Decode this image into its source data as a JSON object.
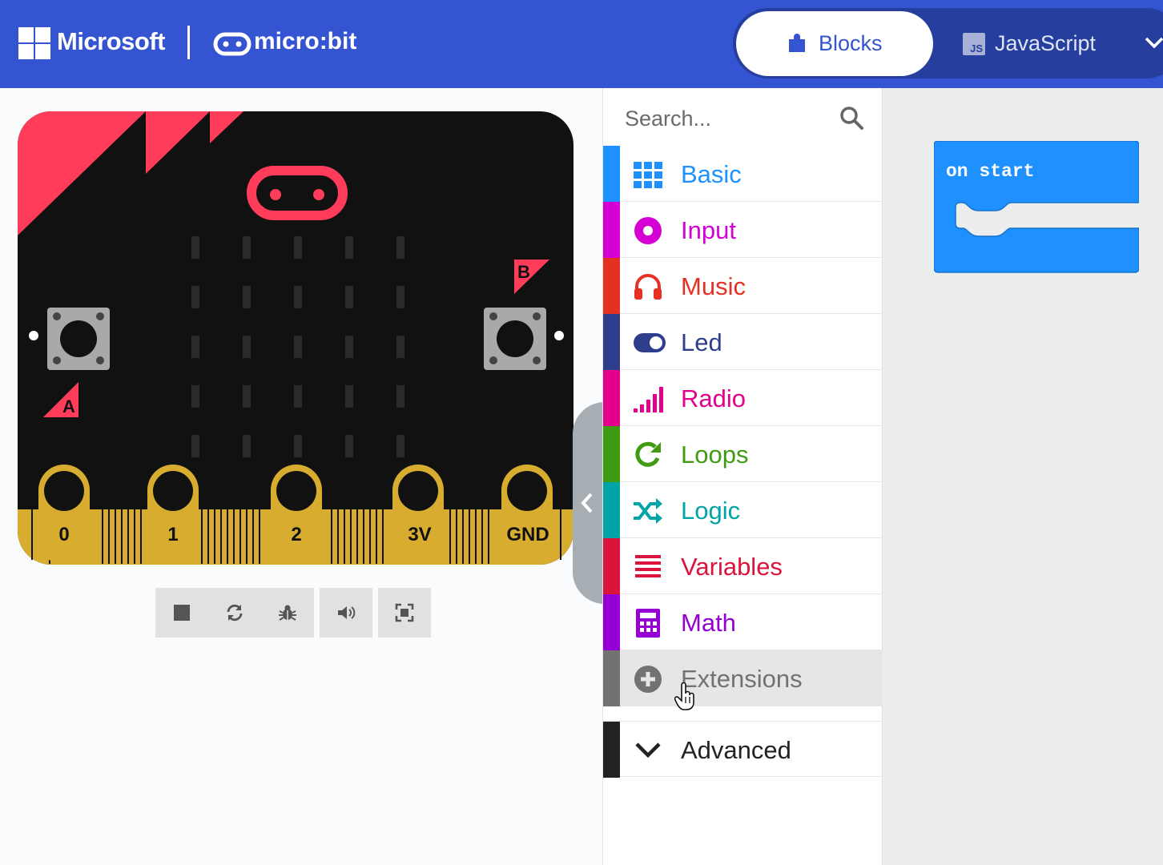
{
  "header": {
    "microsoft_label": "Microsoft",
    "microbit_label": "micro:bit",
    "tabs": [
      {
        "label": "Blocks",
        "active": true,
        "icon": "puzzle-icon"
      },
      {
        "label": "JavaScript",
        "active": false,
        "icon": "js-icon",
        "icon_text": "JS"
      }
    ],
    "dropdown_icon": "chevron-down-icon",
    "colors": {
      "header_bg": "#3454d1",
      "toggle_bg": "#263f9e"
    }
  },
  "simulator": {
    "board_colors": {
      "body": "#111111",
      "accent": "#ff3c5a",
      "pins": "#d8ad2f",
      "buttons": "#a9a9a9"
    },
    "button_a_label": "A",
    "button_b_label": "B",
    "pins": [
      "0",
      "1",
      "2",
      "3V",
      "GND"
    ],
    "controls": [
      {
        "name": "stop",
        "icon": "stop-icon"
      },
      {
        "name": "restart",
        "icon": "restart-icon"
      },
      {
        "name": "debug",
        "icon": "bug-icon"
      },
      {
        "name": "mute",
        "icon": "speaker-icon"
      },
      {
        "name": "fullscreen",
        "icon": "fullscreen-icon"
      }
    ],
    "collapse_icon": "chevron-left-icon"
  },
  "toolbox": {
    "search_placeholder": "Search...",
    "categories": [
      {
        "label": "Basic",
        "color": "#1e90ff",
        "icon": "grid-icon"
      },
      {
        "label": "Input",
        "color": "#d400d4",
        "icon": "input-circle-icon"
      },
      {
        "label": "Music",
        "color": "#e63022",
        "icon": "headphones-icon"
      },
      {
        "label": "Led",
        "color": "#2f3d8d",
        "icon": "toggle-icon"
      },
      {
        "label": "Radio",
        "color": "#e3008c",
        "icon": "signal-bars-icon"
      },
      {
        "label": "Loops",
        "color": "#3e9b12",
        "icon": "loop-arrow-icon"
      },
      {
        "label": "Logic",
        "color": "#00a4a6",
        "icon": "shuffle-icon"
      },
      {
        "label": "Variables",
        "color": "#dc143c",
        "icon": "list-lines-icon"
      },
      {
        "label": "Math",
        "color": "#9400d3",
        "icon": "calculator-icon"
      },
      {
        "label": "Extensions",
        "color": "#727272",
        "icon": "plus-circle-icon",
        "hover": true
      }
    ],
    "advanced": {
      "label": "Advanced",
      "color": "#222222",
      "icon": "chevron-down-icon"
    }
  },
  "workspace": {
    "blocks": [
      {
        "label": "on start",
        "color": "#1e90ff"
      }
    ]
  }
}
